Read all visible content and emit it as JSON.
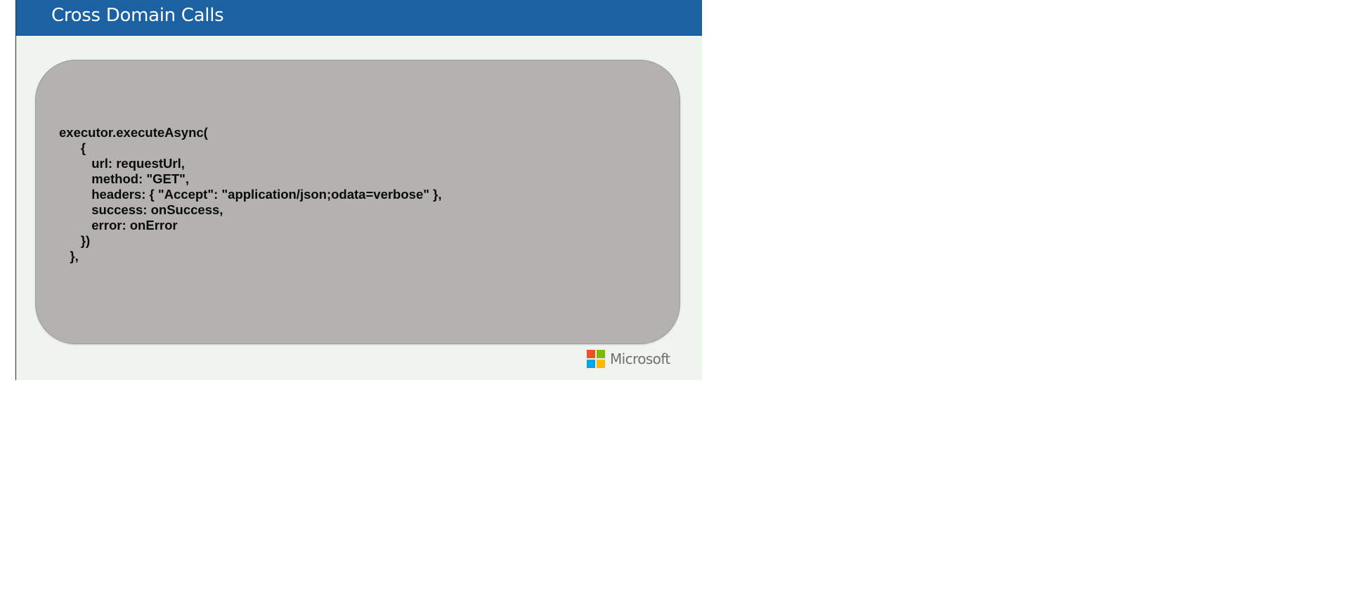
{
  "slide": {
    "title": "Cross Domain Calls",
    "code_lines": [
      "executor.executeAsync(",
      "      {",
      "         url: requestUrl,",
      "         method: \"GET\",",
      "         headers: { \"Accept\": \"application/json;odata=verbose\" },",
      "         success: onSuccess,",
      "         error: onError",
      "      })",
      "   },"
    ],
    "logo": {
      "icon": "microsoft-logo-icon",
      "text": "Microsoft"
    }
  },
  "colors": {
    "title_bar": "#1c62a2",
    "slide_background": "#eff4ef",
    "code_box": "#b4b2ae",
    "logo_red": "#f25022",
    "logo_green": "#7fba00",
    "logo_blue": "#00a4ef",
    "logo_yellow": "#ffb900"
  }
}
